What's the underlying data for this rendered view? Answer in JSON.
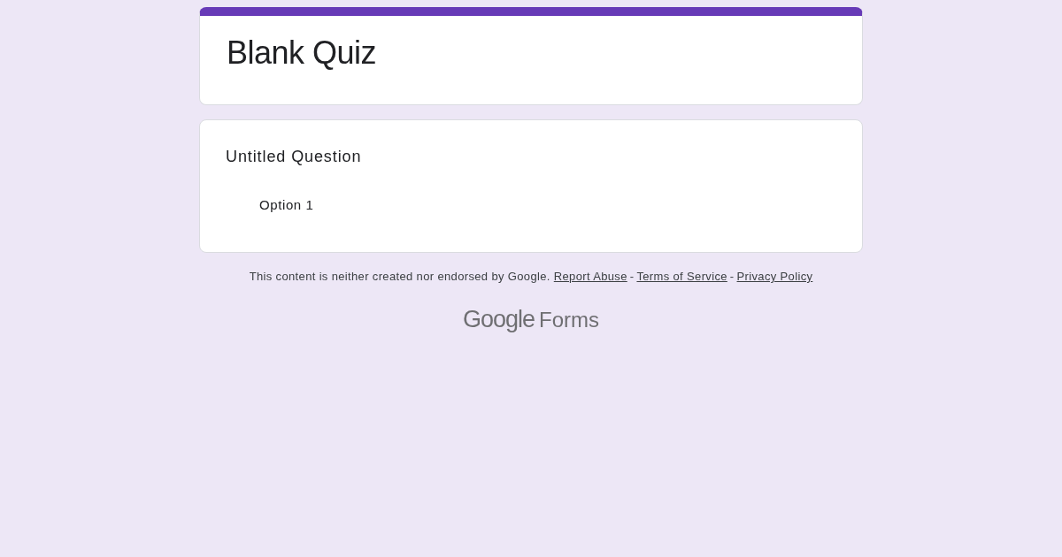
{
  "form": {
    "title": "Blank Quiz"
  },
  "questions": [
    {
      "title": "Untitled Question",
      "options": [
        {
          "label": "Option 1"
        }
      ]
    }
  ],
  "footer": {
    "notice": "This content is neither created nor endorsed by Google.",
    "links": [
      "Report Abuse",
      "Terms of Service",
      "Privacy Policy"
    ],
    "separators": [
      "-",
      "-"
    ]
  },
  "logo": {
    "brand": "Google",
    "product": "Forms"
  }
}
